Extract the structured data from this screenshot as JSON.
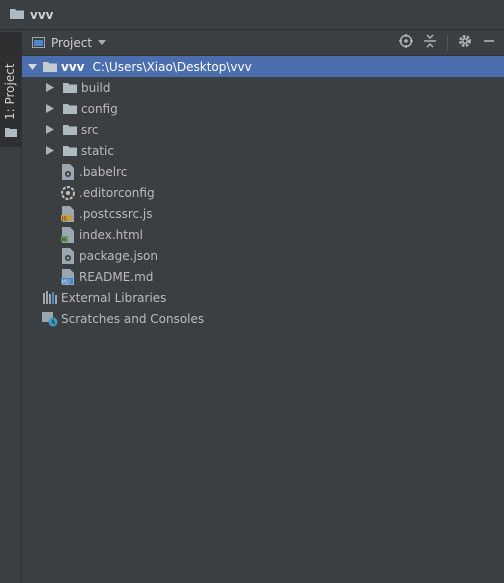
{
  "breadcrumb": {
    "title": "vvv"
  },
  "toolwindow": {
    "tab_label": "1: Project"
  },
  "panel": {
    "title": "Project"
  },
  "tree": {
    "root": {
      "label": "vvv",
      "path": "C:\\Users\\Xiao\\Desktop\\vvv"
    },
    "folders": [
      "build",
      "config",
      "src",
      "static"
    ],
    "files": [
      ".babelrc",
      ".editorconfig",
      ".postcssrc.js",
      "index.html",
      "package.json",
      "README.md"
    ],
    "external": "External Libraries",
    "scratches": "Scratches and Consoles"
  },
  "colors": {
    "selection": "#4b6eaf",
    "folder": "#aeb9c0",
    "background": "#3c3f41"
  }
}
